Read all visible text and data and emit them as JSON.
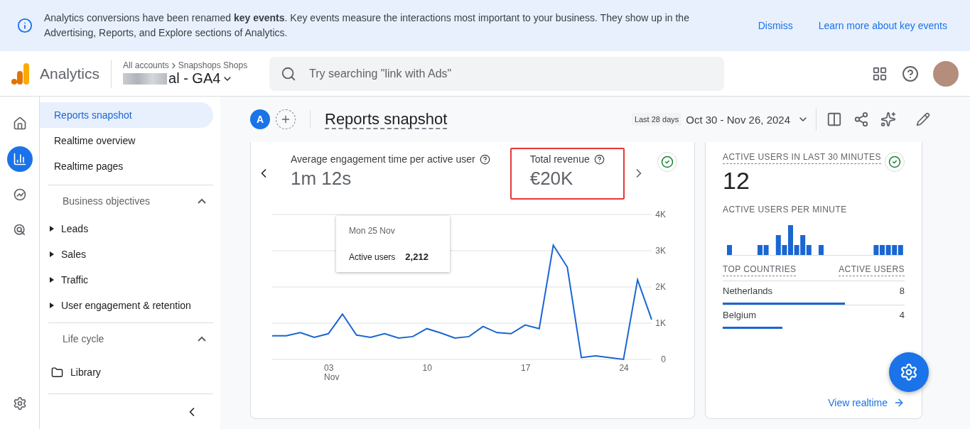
{
  "banner": {
    "message": "Analytics conversions have been renamed **key events**. Key events measure the interactions most important to your business. They show up in the Advertising, Reports, and Explore sections of Analytics.",
    "actions": [
      "Dismiss",
      "Learn more about key events"
    ]
  },
  "header": {
    "product": "Analytics",
    "breadcrumb": [
      "All accounts",
      "Snapshops Shops"
    ],
    "property": "al - GA4",
    "search": {
      "placeholder": "Try searching \"link with Ads\""
    }
  },
  "rail": [
    {
      "selected": false
    },
    {
      "selected": true
    },
    {
      "selected": false
    },
    {
      "selected": false
    }
  ],
  "sidebar": {
    "items": [
      {
        "label": "Reports snapshot",
        "selected": true
      },
      {
        "label": "Realtime overview",
        "selected": false
      },
      {
        "label": "Realtime pages",
        "selected": false
      }
    ],
    "sections": [
      {
        "title": "Business objectives",
        "expanded": true,
        "children": [
          {
            "label": "Leads"
          },
          {
            "label": "Sales"
          },
          {
            "label": "Traffic"
          },
          {
            "label": "User engagement & retention"
          }
        ]
      },
      {
        "title": "Life cycle",
        "expanded": true,
        "children": [
          {
            "label": "Library",
            "kind": "folder"
          }
        ]
      }
    ]
  },
  "toolbar": {
    "avatar": "A",
    "title": "Reports snapshot",
    "range_badge": "Last 28 days",
    "range": "Oct 30 - Nov 26, 2024"
  },
  "metrics": [
    {
      "label": "Average engagement time per active user",
      "value": "1m 12s",
      "highlighted": false
    },
    {
      "label": "Total revenue",
      "value": "€20K",
      "highlighted": true
    }
  ],
  "chart_data": {
    "type": "line",
    "categories": [
      null,
      null,
      null,
      null,
      "03 Nov",
      null,
      null,
      null,
      null,
      null,
      null,
      "10",
      null,
      null,
      null,
      null,
      null,
      null,
      "17",
      null,
      null,
      null,
      null,
      null,
      null,
      "24",
      null,
      null
    ],
    "series": [
      {
        "name": "Active users",
        "color": "#1a66d2",
        "values": [
          650,
          650,
          740,
          610,
          710,
          1250,
          670,
          610,
          710,
          590,
          630,
          850,
          730,
          590,
          630,
          910,
          740,
          710,
          950,
          850,
          3150,
          2550,
          50,
          100,
          50,
          0,
          2200,
          1100
        ]
      }
    ],
    "ylim": [
      0,
      4000
    ],
    "yticks": [
      {
        "value": 0,
        "label": "0"
      },
      {
        "value": 1000,
        "label": "1K"
      },
      {
        "value": 2000,
        "label": "2K"
      },
      {
        "value": 3000,
        "label": "3K"
      },
      {
        "value": 4000,
        "label": "4K"
      }
    ],
    "grid": true
  },
  "tooltip": {
    "date": "Mon 25 Nov",
    "value": "2,212"
  },
  "realtime": {
    "title": "ACTIVE USERS IN LAST 30 MINUTES",
    "value": "12",
    "per_minute_title": "ACTIVE USERS PER MINUTE",
    "columns": [
      "TOP COUNTRIES",
      "ACTIVE USERS"
    ],
    "rows": [
      {
        "country": "Netherlands",
        "users": "8",
        "level": 0.67
      },
      {
        "country": "Belgium",
        "users": "4",
        "level": 0.33
      }
    ],
    "link": "View realtime"
  }
}
